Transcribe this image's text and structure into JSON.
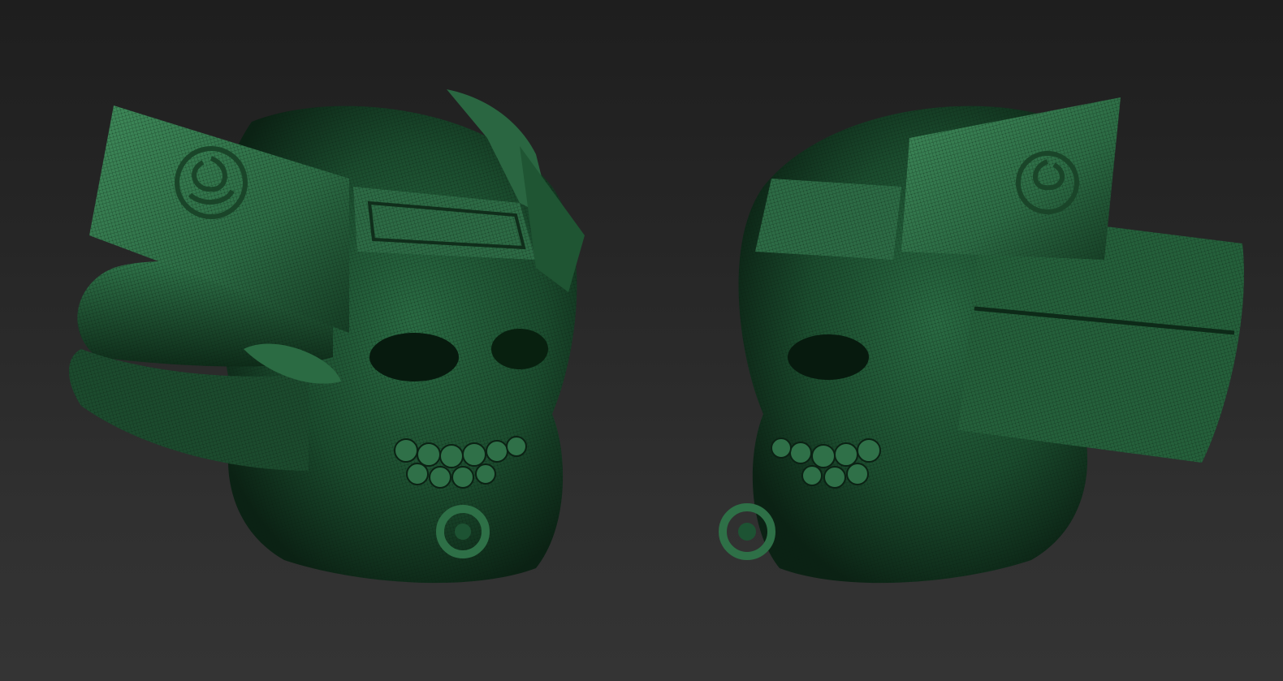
{
  "viewport": {
    "background_colors": [
      "#1e1e1e",
      "#343434"
    ]
  },
  "models": [
    {
      "name": "samurai-helmet-skull-left-view",
      "mesh_color": "#1f5a35",
      "highlight_color": "#3f8a5a",
      "shadow_color": "#0c2416"
    },
    {
      "name": "samurai-helmet-skull-right-view",
      "mesh_color": "#1f5a35",
      "highlight_color": "#3f8a5a",
      "shadow_color": "#0c2416"
    }
  ]
}
